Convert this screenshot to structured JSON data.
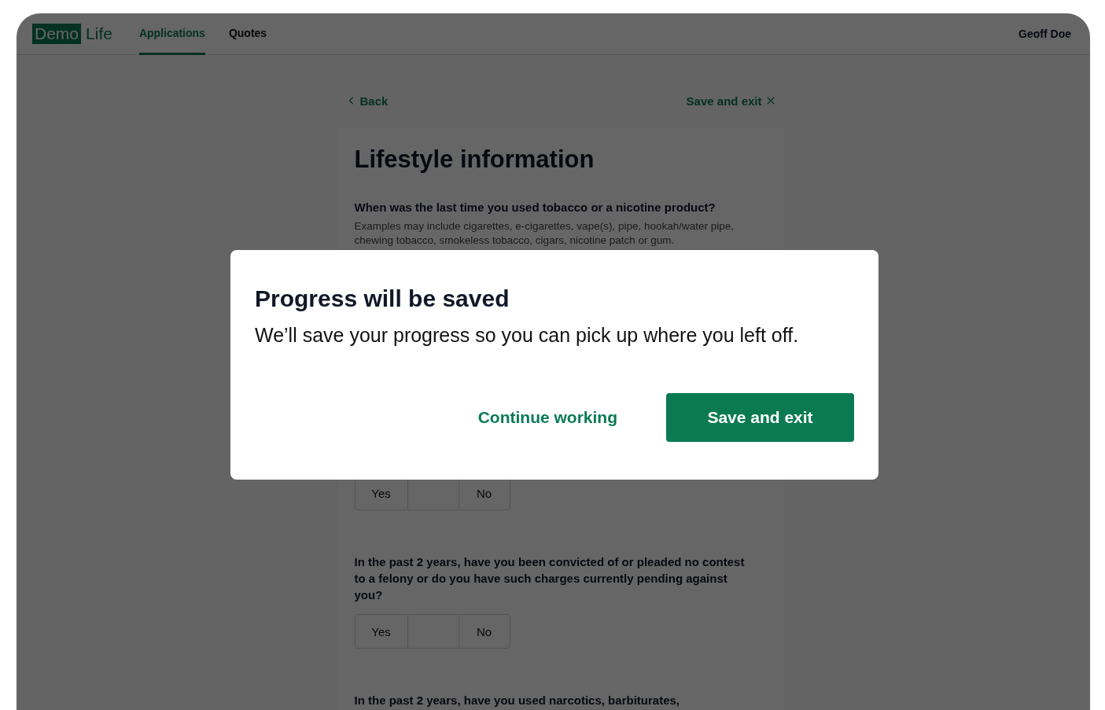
{
  "header": {
    "logo": {
      "box_text": "Demo",
      "text": "Life"
    },
    "tabs": [
      {
        "label": "Applications",
        "selected": true
      },
      {
        "label": "Quotes",
        "selected": false
      }
    ],
    "user": "Geoff Doe"
  },
  "nav": {
    "back": "Back",
    "save_exit": "Save and exit"
  },
  "form": {
    "title": "Lifestyle information",
    "items": [
      {
        "kind": "question",
        "text": "When was the last time you used tobacco or a nicotine product?",
        "hint": "Examples may include cigarettes, e-cigarettes, vape(s), pipe, hookah/water pipe, chewing tobacco, smokeless tobacco, cigars, nicotine patch or gum."
      },
      {
        "kind": "choices",
        "options": [
          {
            "label": "Yes",
            "selected": false
          },
          {
            "selected": false
          },
          {
            "label": "No",
            "selected": false
          }
        ]
      },
      {
        "kind": "question",
        "text": "In the past 2 years, have you been convicted of or pleaded no contest to a felony or do you have such charges currently pending against you?"
      },
      {
        "kind": "choices",
        "options": [
          {
            "label": "Yes",
            "selected": false
          },
          {
            "selected": false
          },
          {
            "label": "No",
            "selected": false
          }
        ]
      },
      {
        "kind": "question",
        "text": "In the past 2 years, have you used narcotics, barbiturates,"
      }
    ]
  },
  "dialog": {
    "title": "Progress will be saved",
    "body": "We’ll save your progress so you can pick up where you left off.",
    "secondary": "Continue working",
    "primary": "Save and exit"
  }
}
